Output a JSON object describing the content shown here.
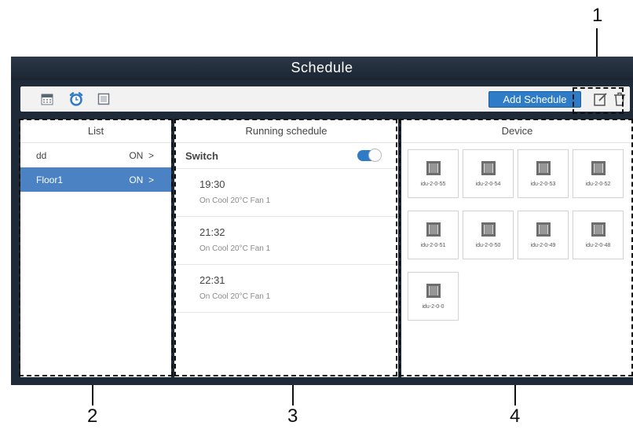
{
  "callouts": [
    "1",
    "2",
    "3",
    "4"
  ],
  "window": {
    "title": "Schedule"
  },
  "toolbar": {
    "icons": [
      "calendar-icon",
      "alarm-clock-icon",
      "checkbox-icon"
    ],
    "add_schedule_label": "Add Schedule",
    "actions": [
      "edit-icon",
      "trash-icon"
    ]
  },
  "list_panel": {
    "header": "List",
    "items": [
      {
        "name": "dd",
        "status": "ON",
        "chevron": ">",
        "selected": false
      },
      {
        "name": "Floor1",
        "status": "ON",
        "chevron": ">",
        "selected": true
      }
    ]
  },
  "schedule_panel": {
    "header": "Running schedule",
    "switch_label": "Switch",
    "switch_on": true,
    "items": [
      {
        "time": "19:30",
        "desc": "On Cool 20°C Fan 1"
      },
      {
        "time": "21:32",
        "desc": "On Cool 20°C Fan 1"
      },
      {
        "time": "22:31",
        "desc": "On Cool 20°C Fan 1"
      }
    ]
  },
  "device_panel": {
    "header": "Device",
    "devices": [
      "idu-2-0-55",
      "idu-2-0-54",
      "idu-2-0-53",
      "idu-2-0-52",
      "idu-2-0-51",
      "idu-2-0-50",
      "idu-2-0-49",
      "idu-2-0-48",
      "idu-2-0-0"
    ]
  },
  "colors": {
    "accent": "#2e7cc8",
    "selected_row": "#4a82c4",
    "window_bg": "#1e2a38"
  }
}
